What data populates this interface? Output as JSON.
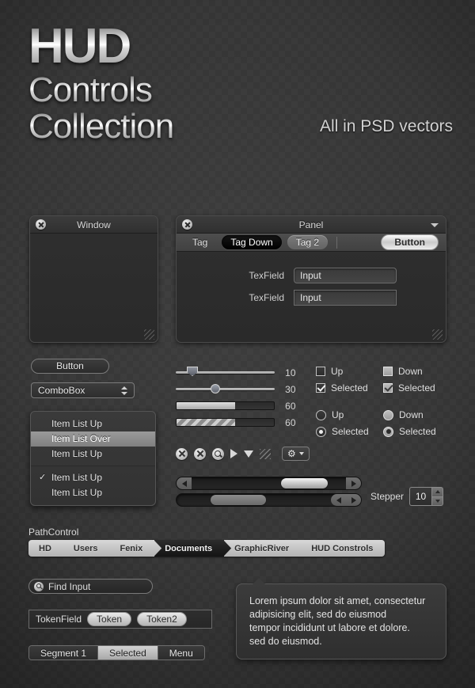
{
  "header": {
    "line1": "HUD",
    "line2": "Controls",
    "line3": "Collection",
    "tagline": "All in PSD vectors"
  },
  "window": {
    "title": "Window",
    "close_icon": "close-icon",
    "grip_icon": "resize-grip-icon"
  },
  "panel": {
    "title": "Panel",
    "menu_icon": "chevron-down-icon",
    "close_icon": "close-icon",
    "tags": [
      {
        "label": "Tag",
        "state": "normal"
      },
      {
        "label": "Tag Down",
        "state": "down"
      },
      {
        "label": "Tag 2",
        "state": "alt"
      }
    ],
    "button": "Button",
    "fields": [
      {
        "label": "TexField",
        "value": "Input",
        "shape": "round"
      },
      {
        "label": "TexField",
        "value": "Input",
        "shape": "square"
      }
    ]
  },
  "left_controls": {
    "button": "Button",
    "combobox": {
      "value": "ComboBox",
      "arrows_icon": "updown-chevron-icon"
    },
    "menu_items": [
      {
        "label": "Item List Up",
        "state": "normal",
        "checked": false
      },
      {
        "label": "Item List Over",
        "state": "over",
        "checked": false
      },
      {
        "label": "Item List Up",
        "state": "normal",
        "checked": false
      },
      {
        "label": "Item List Up",
        "state": "normal",
        "checked": true
      },
      {
        "label": "Item List Up",
        "state": "normal",
        "checked": false
      }
    ],
    "menu_check_glyph": "✓"
  },
  "sliders": [
    {
      "type": "slider",
      "handle": "pentagon",
      "value": "10",
      "position_pct": 12
    },
    {
      "type": "slider",
      "handle": "round",
      "value": "30",
      "position_pct": 35
    },
    {
      "type": "progress",
      "style": "solid",
      "value": "60",
      "fill_pct": 60
    },
    {
      "type": "progress",
      "style": "striped",
      "value": "60",
      "fill_pct": 60
    }
  ],
  "checkboxes": [
    {
      "label": "Up",
      "style": "outline",
      "checked": false
    },
    {
      "label": "Down",
      "style": "filled",
      "checked": false
    },
    {
      "label": "Selected",
      "style": "outline",
      "checked": true
    },
    {
      "label": "Selected",
      "style": "filled",
      "checked": true
    }
  ],
  "radios": [
    {
      "label": "Up",
      "style": "outline",
      "checked": false
    },
    {
      "label": "Down",
      "style": "filled",
      "checked": false
    },
    {
      "label": "Selected",
      "style": "outline",
      "checked": true
    },
    {
      "label": "Selected",
      "style": "filled",
      "checked": true
    }
  ],
  "icon_row": [
    "close-circle-icon",
    "close-circle-icon",
    "search-circle-icon",
    "play-triangle-icon",
    "dropdown-triangle-icon",
    "grip-lines-icon",
    "gear-menu-button"
  ],
  "gear_button": {
    "gear_icon": "gear-icon",
    "arrow_icon": "chevron-down-icon"
  },
  "scrollbars": [
    {
      "name": "scrollbar-split-arrows",
      "thumb_pct": 58,
      "thumb_width_pct": 30,
      "arrows": "split"
    },
    {
      "name": "scrollbar-paired-arrows",
      "thumb_pct": 30,
      "thumb_width_pct": 36,
      "arrows": "paired"
    }
  ],
  "stepper": {
    "label": "Stepper",
    "value": "10",
    "up_icon": "arrow-up-icon",
    "down_icon": "arrow-down-icon"
  },
  "path_control": {
    "label": "PathControl",
    "crumbs": [
      {
        "label": "HD",
        "selected": false
      },
      {
        "label": "Users",
        "selected": false
      },
      {
        "label": "Fenix",
        "selected": false
      },
      {
        "label": "Documents",
        "selected": true
      },
      {
        "label": "GraphicRiver",
        "selected": false
      },
      {
        "label": "HUD Constrols",
        "selected": false
      }
    ]
  },
  "find_input": {
    "icon": "search-icon",
    "value": "Find Input"
  },
  "token_field": {
    "label": "TokenField",
    "tokens": [
      "Token",
      "Token2"
    ]
  },
  "segmented": [
    {
      "label": "Segment 1",
      "selected": false
    },
    {
      "label": "Selected",
      "selected": true
    },
    {
      "label": "Menu",
      "selected": false
    }
  ],
  "tooltip": {
    "lines": [
      "Lorem ipsum dolor sit amet, consectetur",
      "adipisicing elit, sed do eiusmod",
      "tempor incididunt ut labore et dolore.",
      "sed do eiusmod."
    ]
  },
  "colors": {
    "background": "#383838",
    "panel": "#2f2f2f",
    "accent_light": "#d8d8d8",
    "text": "#e3e3e3",
    "selected_dark": "#141414"
  }
}
